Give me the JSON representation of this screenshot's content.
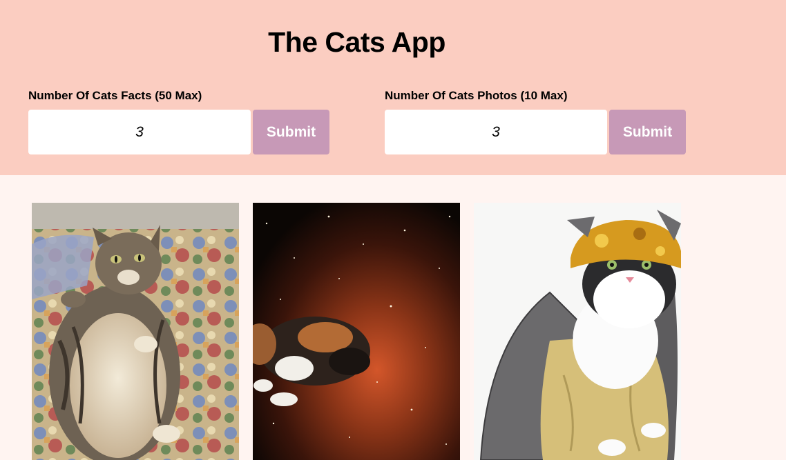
{
  "app": {
    "title": "The Cats App"
  },
  "facts_form": {
    "label": "Number Of Cats Facts (50 Max)",
    "value": "3",
    "submit_label": "Submit"
  },
  "photos_form": {
    "label": "Number Of Cats Photos (10 Max)",
    "value": "3",
    "submit_label": "Submit"
  },
  "colors": {
    "header_bg": "#fbcdc1",
    "page_bg": "#fff4f1",
    "button_bg": "#c799b7",
    "button_text": "#ffffff"
  },
  "gallery": {
    "photos": [
      {
        "subject": "tabby cat lying on floral quilt"
      },
      {
        "subject": "calico cat floating in outer space"
      },
      {
        "subject": "white and black cat in gold costume and hat"
      }
    ]
  }
}
